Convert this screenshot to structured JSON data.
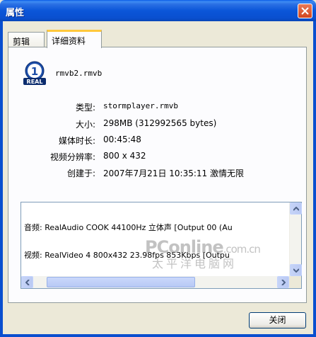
{
  "window": {
    "title": "属性",
    "close_icon": "close-icon"
  },
  "tabs": [
    {
      "label": "剪辑",
      "active": false
    },
    {
      "label": "详细资料",
      "active": true
    }
  ],
  "file": {
    "icon": "real-media-icon",
    "icon_text": "REAL",
    "icon_number": "1",
    "name": "rmvb2.rmvb"
  },
  "details": [
    {
      "label": "类型:",
      "value": "stormplayer.rmvb"
    },
    {
      "label": "大小:",
      "value": "298MB (312992565 bytes)"
    },
    {
      "label": "媒体时长:",
      "value": "00:45:48"
    },
    {
      "label": "视频分辨率:",
      "value": "800 x 432"
    },
    {
      "label": "创建于:",
      "value": "2007年7月21日 10:35:11 激情无限"
    }
  ],
  "streams": [
    "音频: RealAudio COOK 44100Hz 立体声 [Output 00 (Au",
    "视频: RealVideo 4 800x432 23.98fps 853Kbps [Outpu"
  ],
  "watermark": {
    "line1": "PConline",
    "line1_suffix": ".com.cn",
    "line2": "太平洋电脑网"
  },
  "buttons": {
    "close_label": "关闭"
  },
  "colors": {
    "titlebar": "#0a5de8",
    "active_tab_accent": "#ffc83c",
    "dialog_bg": "#ece9d8"
  }
}
